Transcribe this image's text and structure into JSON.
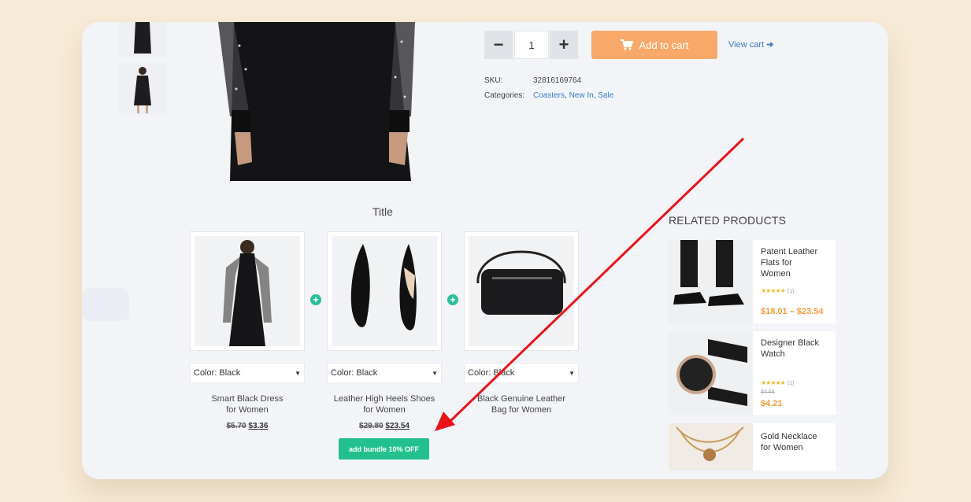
{
  "product": {
    "quantity": "1",
    "add_to_cart": "Add to cart",
    "view_cart": "View cart",
    "sku_label": "SKU:",
    "sku_value": "32816169764",
    "categories_label": "Categories:",
    "categories": [
      "Coasters",
      "New In",
      "Sale"
    ]
  },
  "bundle": {
    "title": "Title",
    "items": [
      {
        "select": "Color: Black",
        "name_line1": "Smart Black Dress",
        "name_line2": "for Women",
        "old_price": "$5.70",
        "price": "$3.36"
      },
      {
        "select": "Color: Black",
        "name_line1": "Leather High Heels Shoes",
        "name_line2": "for Women",
        "old_price": "$29.80",
        "price": "$23.54"
      },
      {
        "select": "Color: Black",
        "name_line1": "Black Genuine Leather",
        "name_line2": "Bag for Women",
        "old_price": "",
        "price": ""
      }
    ],
    "button": "add bundle 10% OFF"
  },
  "related": {
    "title": "RELATED PRODUCTS",
    "items": [
      {
        "name_line1": "Patent Leather",
        "name_line2": "Flats for",
        "name_line3": "Women",
        "rating_count": "(1)",
        "price": "$18.01 – $23.54",
        "rating": 5
      },
      {
        "name_line1": "Designer Black",
        "name_line2": "Watch",
        "rating_count": "(1)",
        "old_price": "$4.68",
        "price": "$4.21",
        "rating": 5
      },
      {
        "name_line1": "Gold Necklace",
        "name_line2": "for Women"
      }
    ]
  },
  "colors": {
    "accent_orange": "#f8a868",
    "bundle_green": "#22c08d",
    "link_blue": "#3a7bbf",
    "arrow_red": "#e8141a"
  }
}
